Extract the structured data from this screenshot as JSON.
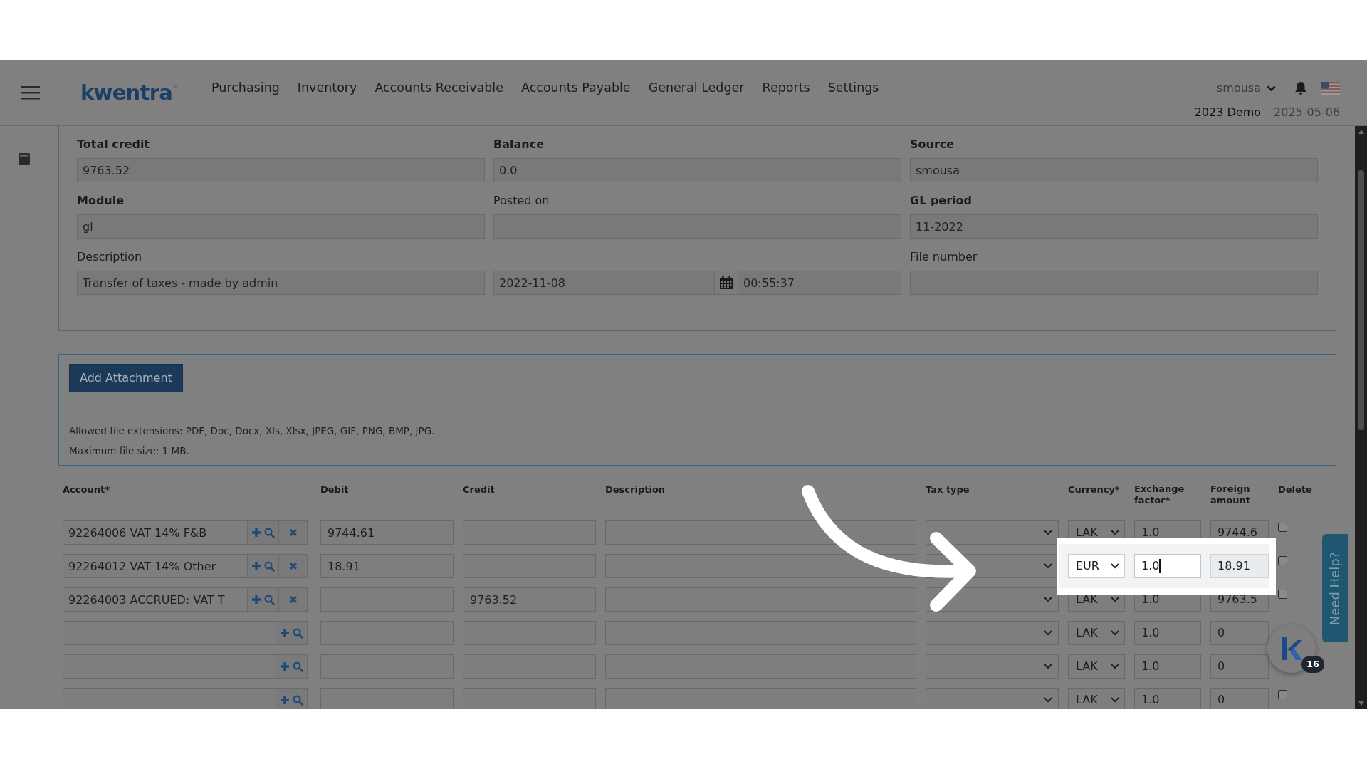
{
  "header": {
    "logo": "kwentra",
    "logo_mark": "™",
    "nav": [
      "Purchasing",
      "Inventory",
      "Accounts Receivable",
      "Accounts Payable",
      "General Ledger",
      "Reports",
      "Settings"
    ],
    "user": "smousa",
    "company": "2023 Demo",
    "date": "2025-05-06"
  },
  "form": {
    "rows": [
      [
        {
          "kind": "text",
          "label": "Total credit",
          "bold": true,
          "value": "9763.52"
        },
        {
          "kind": "text",
          "label": "Balance",
          "bold": true,
          "value": "0.0"
        },
        {
          "kind": "text",
          "label": "Source",
          "bold": true,
          "value": "smousa"
        }
      ],
      [
        {
          "kind": "text",
          "label": "Module",
          "bold": true,
          "value": "gl"
        },
        {
          "kind": "text",
          "label": "Posted on",
          "bold": false
        },
        {
          "kind": "text",
          "label": "GL period",
          "bold": true,
          "value": "11-2022"
        }
      ],
      [
        {
          "kind": "text",
          "label": "Description",
          "bold": false,
          "value": "Transfer of taxes - made by admin"
        },
        {
          "kind": "datetime",
          "date": "2022-11-08",
          "time": "00:55:37"
        },
        {
          "kind": "text",
          "label": "File number",
          "bold": false
        }
      ]
    ]
  },
  "attachments": {
    "button": "Add Attachment",
    "notes": [
      "Allowed file extensions: PDF, Doc, Docx, Xls, Xlsx, JPEG, GIF, PNG, BMP, JPG.",
      "Maximum file size: 1 MB."
    ]
  },
  "table": {
    "columns": [
      "Account*",
      "Debit",
      "Credit",
      "Description",
      "Tax type",
      "Currency*",
      "Exchange factor*",
      "Foreign amount",
      "Delete"
    ],
    "rows": [
      {
        "account": "92264006 VAT 14% F&B",
        "removable": true,
        "debit": "9744.61",
        "currency": "LAK",
        "exchange_factor": "1.0",
        "foreign_amount": "9744.6",
        "highlighted": false,
        "delete": {
          "checked": false
        }
      },
      {
        "account": "92264012 VAT 14% Other",
        "removable": true,
        "debit": "18.91",
        "currency": "EUR",
        "exchange_factor": "1.0",
        "foreign_amount": "18.91",
        "highlighted": true,
        "focused": true,
        "delete": {
          "checked": false
        }
      },
      {
        "account": "92264003 ACCRUED: VAT T",
        "removable": true,
        "credit": "9763.52",
        "currency": "LAK",
        "exchange_factor": "1.0",
        "foreign_amount": "9763.5",
        "highlighted": false,
        "delete": {
          "checked": false
        }
      },
      {
        "removable": false,
        "currency": "LAK",
        "exchange_factor": "1.0",
        "foreign_amount": "0",
        "highlighted": false
      },
      {
        "removable": false,
        "currency": "LAK",
        "exchange_factor": "1.0",
        "foreign_amount": "0",
        "highlighted": false
      },
      {
        "removable": false,
        "currency": "LAK",
        "exchange_factor": "1.0",
        "foreign_amount": "0",
        "highlighted": false,
        "delete": {
          "checked": false
        }
      }
    ]
  },
  "help": {
    "tab": "Need Help?",
    "badge": "16"
  }
}
